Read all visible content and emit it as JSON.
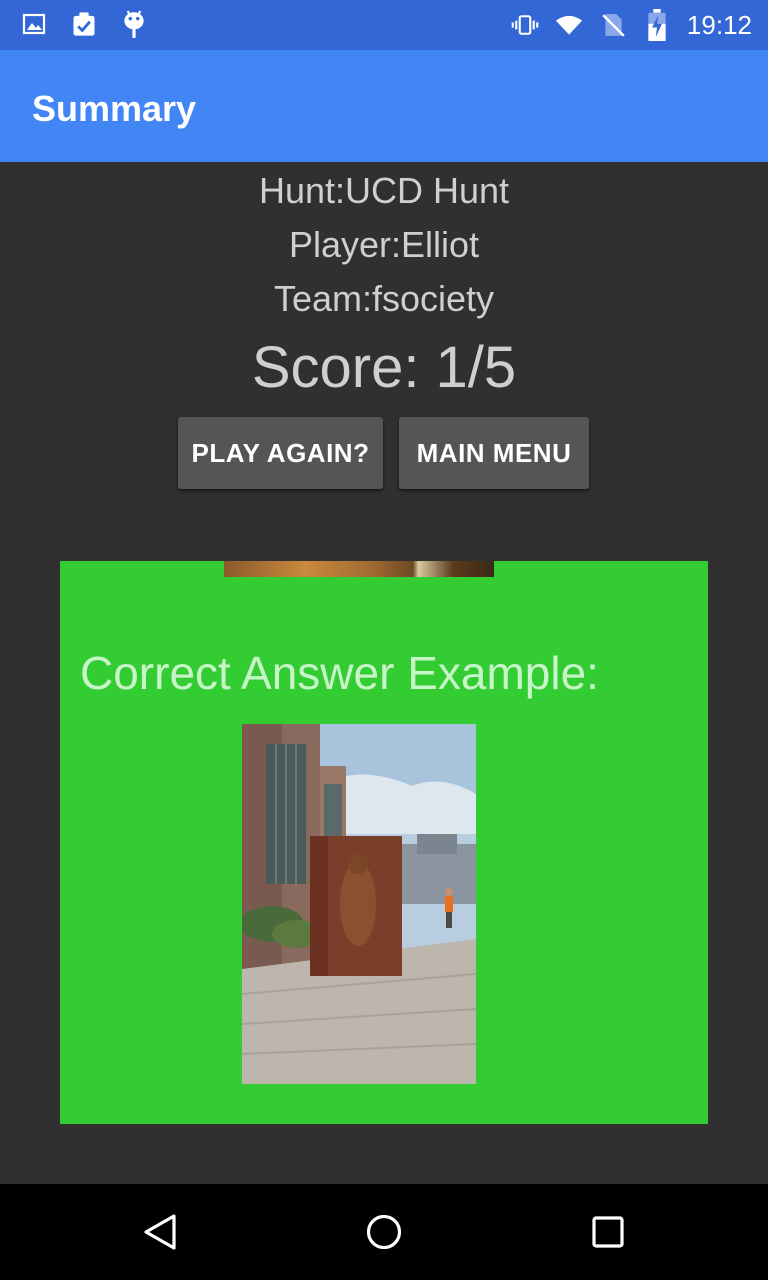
{
  "status_bar": {
    "time": "19:12",
    "left_icons": [
      "gallery-icon",
      "clipboard-check-icon",
      "android-debug-icon"
    ],
    "right_icons": [
      "vibrate-icon",
      "wifi-icon",
      "no-sim-icon",
      "battery-charging-icon"
    ]
  },
  "app_bar": {
    "title": "Summary"
  },
  "summary": {
    "hunt": "Hunt:UCD Hunt",
    "player": "Player:Elliot",
    "team": "Team:fsociety",
    "score": "Score: 1/5"
  },
  "buttons": {
    "play_again": "PLAY AGAIN?",
    "main_menu": "MAIN MENU"
  },
  "card": {
    "heading": "Correct Answer Example:",
    "background": "#33cc33"
  },
  "nav_bar": {
    "icons": [
      "back-icon",
      "home-icon",
      "recents-icon"
    ]
  },
  "colors": {
    "status_bar": "#3367d6",
    "app_bar": "#4285f4",
    "background": "#303030",
    "button": "#555555"
  }
}
